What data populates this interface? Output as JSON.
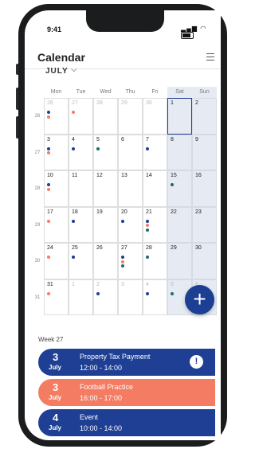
{
  "status": {
    "time": "9:41"
  },
  "header": {
    "title": "Calendar"
  },
  "month_selector": {
    "label": "JULY"
  },
  "weekdays": [
    "Mon",
    "Tue",
    "Wed",
    "Thu",
    "Fri",
    "Sat",
    "Sun"
  ],
  "weeks": [
    {
      "number": "26",
      "days": [
        {
          "day": "26",
          "other": true,
          "dots": [
            "blue",
            "orange"
          ]
        },
        {
          "day": "27",
          "other": true,
          "dots": [
            "orange"
          ]
        },
        {
          "day": "28",
          "other": true,
          "dots": []
        },
        {
          "day": "29",
          "other": true,
          "dots": []
        },
        {
          "day": "30",
          "other": true,
          "dots": []
        },
        {
          "day": "1",
          "other": false,
          "today": true,
          "dots": []
        },
        {
          "day": "2",
          "other": false,
          "dots": []
        }
      ]
    },
    {
      "number": "27",
      "days": [
        {
          "day": "3",
          "other": false,
          "dots": [
            "blue",
            "orange"
          ]
        },
        {
          "day": "4",
          "other": false,
          "dots": [
            "blue"
          ]
        },
        {
          "day": "5",
          "other": false,
          "dots": [
            "teal"
          ]
        },
        {
          "day": "6",
          "other": false,
          "dots": []
        },
        {
          "day": "7",
          "other": false,
          "dots": [
            "blue"
          ]
        },
        {
          "day": "8",
          "other": false,
          "dots": []
        },
        {
          "day": "9",
          "other": false,
          "dots": []
        }
      ]
    },
    {
      "number": "28",
      "days": [
        {
          "day": "10",
          "other": false,
          "dots": [
            "blue",
            "orange"
          ]
        },
        {
          "day": "11",
          "other": false,
          "dots": []
        },
        {
          "day": "12",
          "other": false,
          "dots": []
        },
        {
          "day": "13",
          "other": false,
          "dots": []
        },
        {
          "day": "14",
          "other": false,
          "dots": []
        },
        {
          "day": "15",
          "other": false,
          "dots": [
            "teal"
          ]
        },
        {
          "day": "16",
          "other": false,
          "dots": []
        }
      ]
    },
    {
      "number": "29",
      "days": [
        {
          "day": "17",
          "other": false,
          "dots": [
            "orange"
          ]
        },
        {
          "day": "18",
          "other": false,
          "dots": [
            "blue"
          ]
        },
        {
          "day": "19",
          "other": false,
          "dots": []
        },
        {
          "day": "20",
          "other": false,
          "dots": [
            "blue"
          ]
        },
        {
          "day": "21",
          "other": false,
          "dots": [
            "blue",
            "orange",
            "teal"
          ]
        },
        {
          "day": "22",
          "other": false,
          "dots": []
        },
        {
          "day": "23",
          "other": false,
          "dots": []
        }
      ]
    },
    {
      "number": "30",
      "days": [
        {
          "day": "24",
          "other": false,
          "dots": [
            "orange"
          ]
        },
        {
          "day": "25",
          "other": false,
          "dots": [
            "blue"
          ]
        },
        {
          "day": "26",
          "other": false,
          "dots": []
        },
        {
          "day": "27",
          "other": false,
          "dots": [
            "blue",
            "orange",
            "teal"
          ]
        },
        {
          "day": "28",
          "other": false,
          "dots": [
            "teal"
          ]
        },
        {
          "day": "29",
          "other": false,
          "dots": []
        },
        {
          "day": "30",
          "other": false,
          "dots": []
        }
      ]
    },
    {
      "number": "31",
      "days": [
        {
          "day": "31",
          "other": false,
          "dots": [
            "orange"
          ]
        },
        {
          "day": "1",
          "other": true,
          "dots": []
        },
        {
          "day": "2",
          "other": true,
          "dots": [
            "blue"
          ]
        },
        {
          "day": "3",
          "other": true,
          "dots": []
        },
        {
          "day": "4",
          "other": true,
          "dots": [
            "blue"
          ]
        },
        {
          "day": "5",
          "other": true,
          "dots": [
            "teal"
          ]
        },
        {
          "day": "6",
          "other": true,
          "dots": []
        }
      ]
    }
  ],
  "week_label": "Week 27",
  "events": [
    {
      "day": "3",
      "month": "July",
      "title": "Property Tax Payment",
      "time": "12:00 - 14:00",
      "color": "blue",
      "alert": "!"
    },
    {
      "day": "3",
      "month": "July",
      "title": "Football Practice",
      "time": "16:00 - 17:00",
      "color": "orange",
      "alert": ""
    },
    {
      "day": "4",
      "month": "July",
      "title": "Event",
      "time": "10:00 - 14:00",
      "color": "blue",
      "alert": ""
    }
  ],
  "fab": {
    "label": "+"
  },
  "colors": {
    "primary": "#1e3f94",
    "accent": "#f37c63",
    "teal": "#1f6a6b",
    "weekend": "#e5eaf3"
  }
}
